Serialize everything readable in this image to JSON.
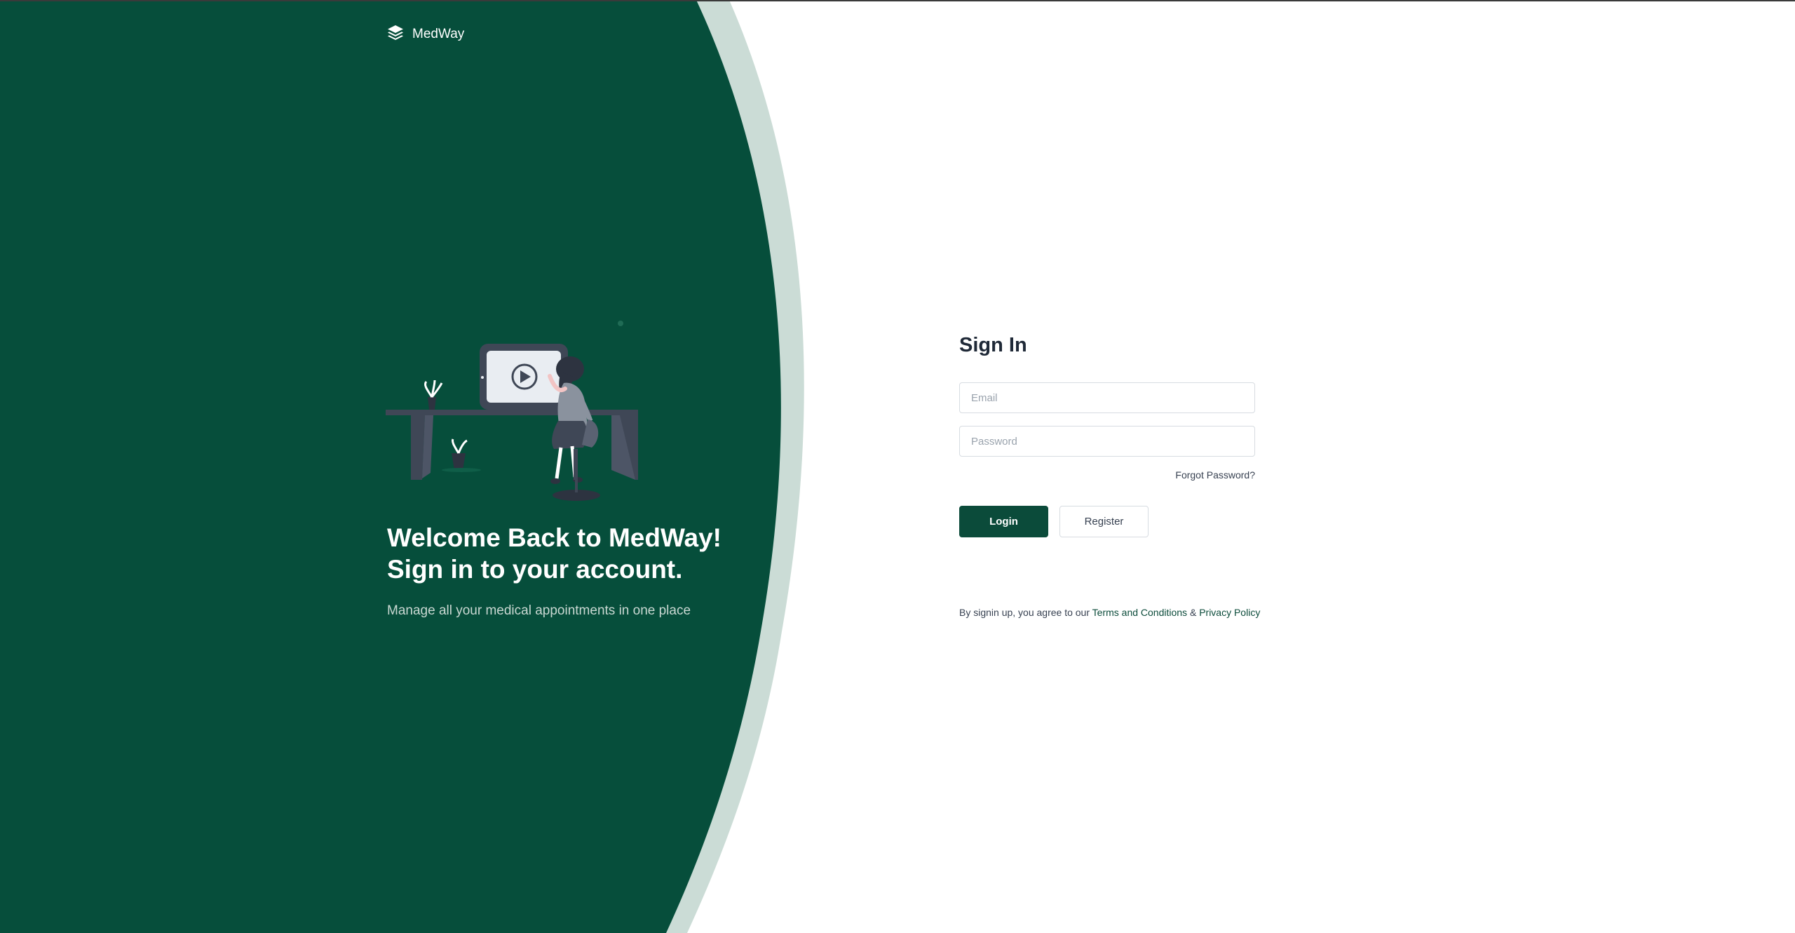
{
  "colors": {
    "brand_green": "#064e3b",
    "arc_light": "#cbdcd6",
    "text_dark": "#1f2937"
  },
  "brand": {
    "name": "MedWay",
    "icon": "layers-icon"
  },
  "hero": {
    "title_line1": "Welcome Back to MedWay!",
    "title_line2": "Sign in to your account.",
    "subtitle": "Manage all your medical appointments in one place"
  },
  "signin": {
    "title": "Sign In",
    "email_placeholder": "Email",
    "password_placeholder": "Password",
    "forgot_label": "Forgot Password?",
    "login_label": "Login",
    "register_label": "Register",
    "terms_prefix": "By signin up, you agree to our ",
    "terms_link": "Terms and Conditions",
    "terms_amp": " & ",
    "privacy_link": "Privacy Policy"
  }
}
